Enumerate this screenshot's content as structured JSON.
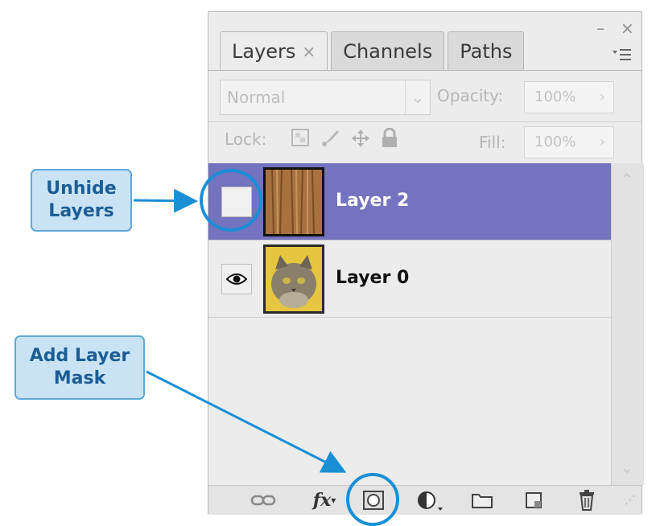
{
  "window": {
    "minimize_icon": "minimize-icon",
    "close_icon": "close-icon"
  },
  "tabs": [
    {
      "label": "Layers",
      "close": "×",
      "active": true
    },
    {
      "label": "Channels",
      "active": false
    },
    {
      "label": "Paths",
      "active": false
    }
  ],
  "panel_menu_icon": "flyout-menu-icon",
  "blend_mode": {
    "value": "Normal"
  },
  "opacity": {
    "label": "Opacity:",
    "value": "100%"
  },
  "lock": {
    "label": "Lock:",
    "icons": [
      "lock-transparent-icon",
      "lock-image-icon",
      "lock-position-icon",
      "lock-all-icon"
    ]
  },
  "fill": {
    "label": "Fill:",
    "value": "100%"
  },
  "layers": [
    {
      "name": "Layer 2",
      "visible": false,
      "selected": true,
      "thumbnail": "wood-texture-thumbnail"
    },
    {
      "name": "Layer 0",
      "visible": true,
      "selected": false,
      "thumbnail": "cat-photo-thumbnail"
    }
  ],
  "bottom_toolbar": [
    "link-layers-icon",
    "fx-icon",
    "add-layer-mask-icon",
    "adjustment-layer-icon",
    "new-group-icon",
    "new-layer-icon",
    "delete-layer-icon"
  ],
  "callouts": {
    "unhide": {
      "line1": "Unhide",
      "line2": "Layers"
    },
    "mask": {
      "line1": "Add Layer",
      "line2": "Mask"
    }
  },
  "colors": {
    "selected_row": "#7373bf",
    "callout_fill": "#c9e3f5",
    "callout_text": "#1c5d95",
    "annotation_blue": "#1a8fd6"
  }
}
